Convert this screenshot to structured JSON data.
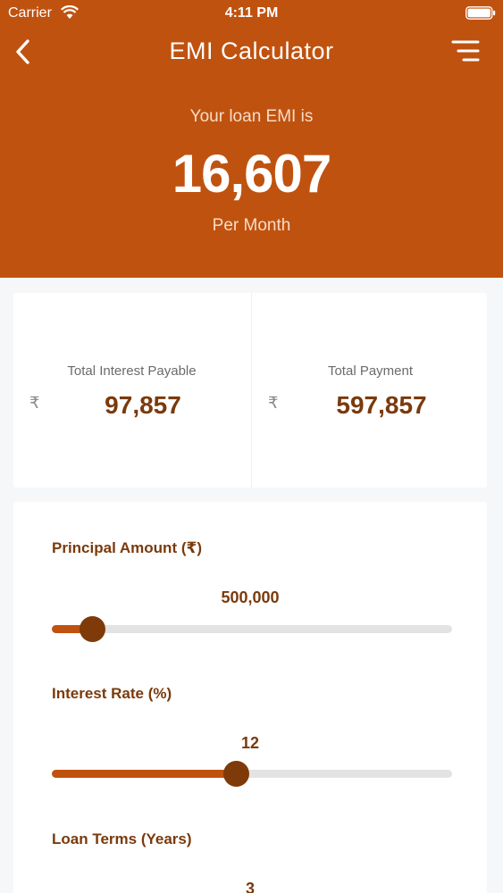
{
  "status_bar": {
    "carrier": "Carrier",
    "time": "4:11 PM"
  },
  "nav": {
    "title": "EMI Calculator",
    "back_icon": "chevron-left-icon",
    "menu_icon": "menu-icon"
  },
  "emi": {
    "caption": "Your loan EMI is",
    "value": "16,607",
    "unit": "Per Month"
  },
  "summary": {
    "currency_symbol": "₹",
    "interest_label": "Total Interest Payable",
    "interest_value": "97,857",
    "payment_label": "Total Payment",
    "payment_value": "597,857"
  },
  "fields": {
    "principal": {
      "label": "Principal Amount (₹)",
      "value": "500,000",
      "fraction": 0.1
    },
    "rate": {
      "label": "Interest Rate (%)",
      "value": "12",
      "fraction": 0.46
    },
    "terms": {
      "label": "Loan Terms (Years)",
      "value": "3"
    }
  },
  "colors": {
    "header": "#c0520f",
    "accent_dark": "#7a3a0c",
    "thumb": "#7e3a08",
    "track": "#e3e3e3"
  }
}
